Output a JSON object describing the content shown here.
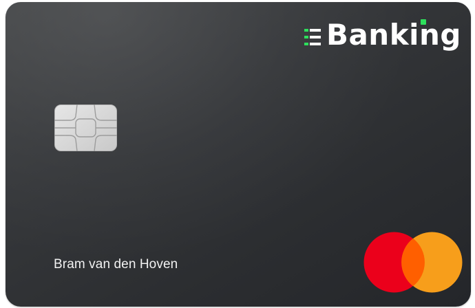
{
  "card": {
    "brand": {
      "name": "Banking",
      "mark_icon": "three-lines-e-icon",
      "accent_color": "#2ee05c"
    },
    "chip_icon": "emv-chip-icon",
    "cardholder_name": "Bram van den Hoven",
    "network_logo": "mastercard-logo",
    "colors": {
      "card_background": "#2f3134",
      "mastercard_red": "#eb001b",
      "mastercard_orange": "#f79e1b",
      "mastercard_overlap": "#ff5f00"
    }
  }
}
